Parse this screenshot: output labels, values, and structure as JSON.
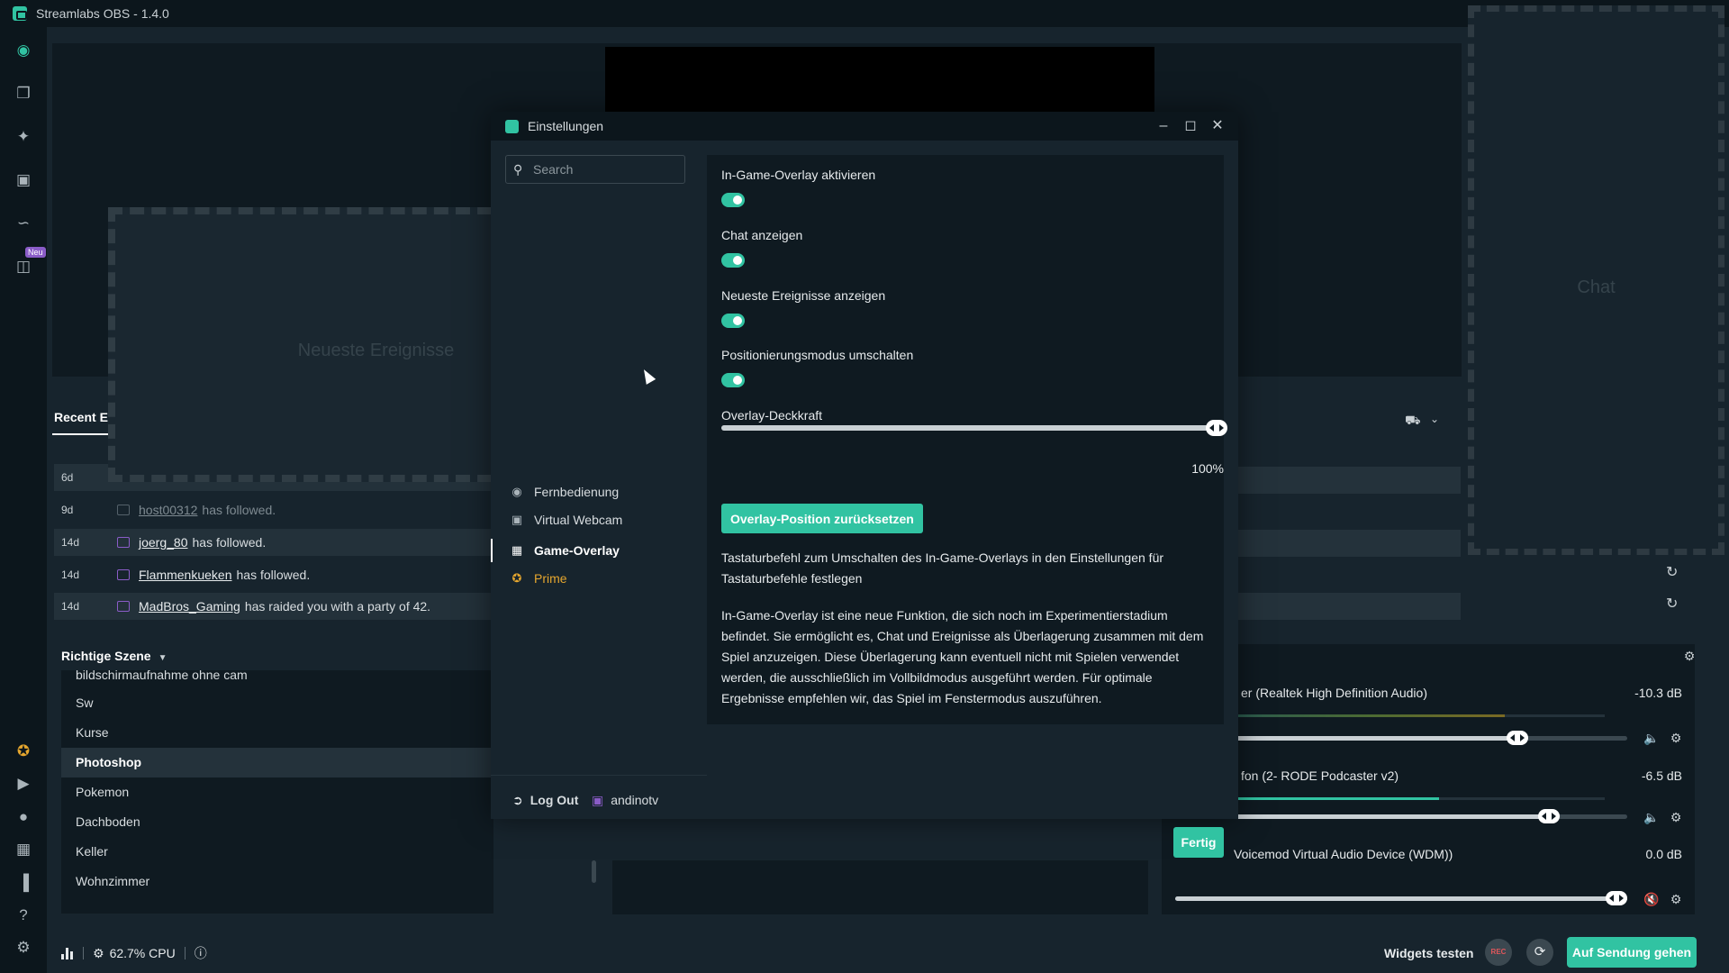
{
  "app": {
    "title": "Streamlabs OBS - 1.4.0"
  },
  "leftnav": {
    "items": [
      {
        "icon": "camera-icon"
      },
      {
        "icon": "layers-icon"
      },
      {
        "icon": "themes-icon"
      },
      {
        "icon": "store-icon"
      },
      {
        "icon": "stats-icon"
      },
      {
        "icon": "video-editor-icon",
        "badge": "Neu"
      }
    ],
    "bottom": [
      {
        "icon": "prime-icon"
      },
      {
        "icon": "dashboard-icon"
      },
      {
        "icon": "chat-icon"
      },
      {
        "icon": "layout-icon"
      },
      {
        "icon": "studio-mode-icon"
      },
      {
        "icon": "help-icon"
      },
      {
        "icon": "settings-icon"
      }
    ]
  },
  "editor": {
    "events_overlay_label": "Neueste Ereignisse",
    "chat_label": "Chat",
    "stray_text": "ı"
  },
  "recent_events": {
    "title": "Recent Ev",
    "rows": [
      {
        "age": "6d",
        "user": "",
        "text": ""
      },
      {
        "age": "9d",
        "user": "host00312",
        "text": "has followed."
      },
      {
        "age": "14d",
        "user": "joerg_80",
        "text": "has followed."
      },
      {
        "age": "14d",
        "user": "Flammenkueken",
        "text": "has followed."
      },
      {
        "age": "14d",
        "user": "MadBros_Gaming",
        "text": "has raided you with a party of 42."
      }
    ]
  },
  "scenes": {
    "title": "Richtige Szene",
    "items": [
      "bildschirmaufnahme ohne cam",
      "Sw",
      "Kurse",
      "Photoshop",
      "Pokemon",
      "Dachboden",
      "Keller",
      "Wohnzimmer"
    ],
    "selected": "Photoshop"
  },
  "mixer": {
    "sources": [
      {
        "name": "er (Realtek High Definition Audio)",
        "db": "-10.3 dB",
        "level": 0.73,
        "volume": 0.72
      },
      {
        "name": "fon (2- RODE Podcaster v2)",
        "db": "-6.5 dB",
        "level": 0.55,
        "volume": 0.8
      },
      {
        "name": "Voicemod Virtual Audio Device (WDM))",
        "db": "0.0 dB",
        "level": 0,
        "volume": 1.0
      }
    ]
  },
  "footer": {
    "cpu": "62.7% CPU",
    "widgets_test": "Widgets testen",
    "rec": "REC",
    "go_live": "Auf Sendung gehen"
  },
  "settings": {
    "title": "Einstellungen",
    "search_placeholder": "Search",
    "categories": [
      {
        "label": "Fernbedienung",
        "icon": "remote-icon"
      },
      {
        "label": "Virtual Webcam",
        "icon": "webcam-icon"
      },
      {
        "label": "Game-Overlay",
        "icon": "overlay-icon",
        "active": true
      },
      {
        "label": "Prime",
        "icon": "prime-icon",
        "prime": true
      }
    ],
    "logout": "Log Out",
    "account": "andinotv",
    "options": [
      {
        "label": "In-Game-Overlay aktivieren",
        "on": true
      },
      {
        "label": "Chat anzeigen",
        "on": true
      },
      {
        "label": "Neueste Ereignisse anzeigen",
        "on": true
      },
      {
        "label": "Positionierungsmodus umschalten",
        "on": true
      }
    ],
    "opacity": {
      "label": "Overlay-Deckkraft",
      "value": 1.0,
      "display": "100%"
    },
    "reset_button": "Overlay-Position zurücksetzen",
    "hotkey_desc": "Tastaturbefehl zum Umschalten des In-Game-Overlays in den Einstellungen für Tastaturbefehle festlegen",
    "info_desc": "In-Game-Overlay ist eine neue Funktion, die sich noch im Experimentierstadium befindet. Sie ermöglicht es, Chat und Ereignisse als Überlagerung zusammen mit dem Spiel anzuzeigen. Diese Überlagerung kann eventuell nicht mit Spielen verwendet werden, die ausschließlich im Vollbildmodus ausgeführt werden. Für optimale Ergebnisse empfehlen wir, das Spiel im Fenstermodus auszuführen.",
    "done_button": "Fertig"
  }
}
